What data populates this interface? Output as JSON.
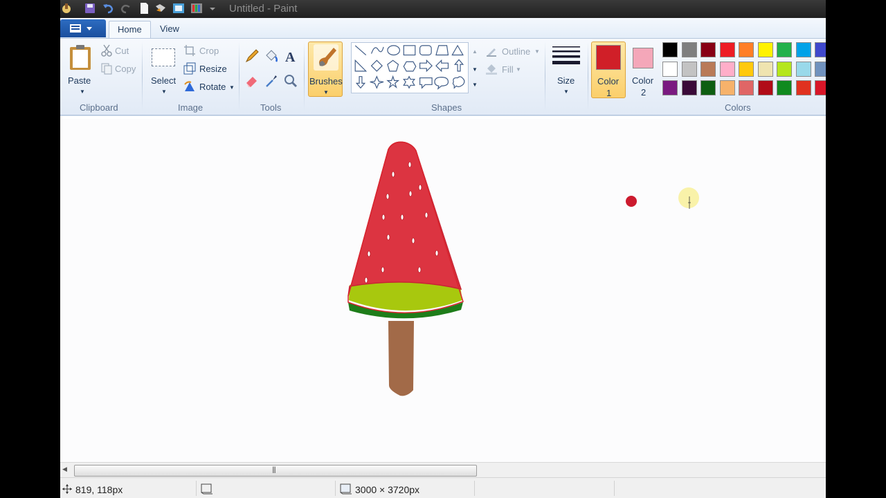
{
  "window": {
    "title": "Untitled - Paint"
  },
  "tabs": {
    "home": "Home",
    "view": "View"
  },
  "clipboard": {
    "paste": "Paste",
    "cut": "Cut",
    "copy": "Copy",
    "group": "Clipboard"
  },
  "image": {
    "select": "Select",
    "crop": "Crop",
    "resize": "Resize",
    "rotate": "Rotate",
    "group": "Image"
  },
  "tools": {
    "group": "Tools"
  },
  "brushes": {
    "label": "Brushes"
  },
  "shapes": {
    "outline": "Outline",
    "fill": "Fill",
    "group": "Shapes"
  },
  "size": {
    "label": "Size"
  },
  "colors": {
    "color1_label": "Color",
    "color1_num": "1",
    "color1_value": "#d01f28",
    "color2_label": "Color",
    "color2_num": "2",
    "color2_value": "#f4a7b9",
    "group": "Colors",
    "palette": [
      [
        "#000000",
        "#7f7f7f",
        "#880015",
        "#ed1c24",
        "#ff7f27",
        "#fff200",
        "#22b14c",
        "#00a2e8",
        "#3f48cc"
      ],
      [
        "#ffffff",
        "#c3c3c3",
        "#b97a57",
        "#ffaec9",
        "#ffc90e",
        "#efe4b0",
        "#b5e61d",
        "#99d9ea",
        "#7092be"
      ],
      [
        "#7a1a80",
        "#3a0a38",
        "#0f5e12",
        "#f6b26b",
        "#e06666",
        "#b10c18",
        "#108a1f",
        "#e0311f",
        "#d81628"
      ]
    ]
  },
  "status": {
    "cursor_pos": "819, 118px",
    "canvas_size": "3000 × 3720px"
  }
}
